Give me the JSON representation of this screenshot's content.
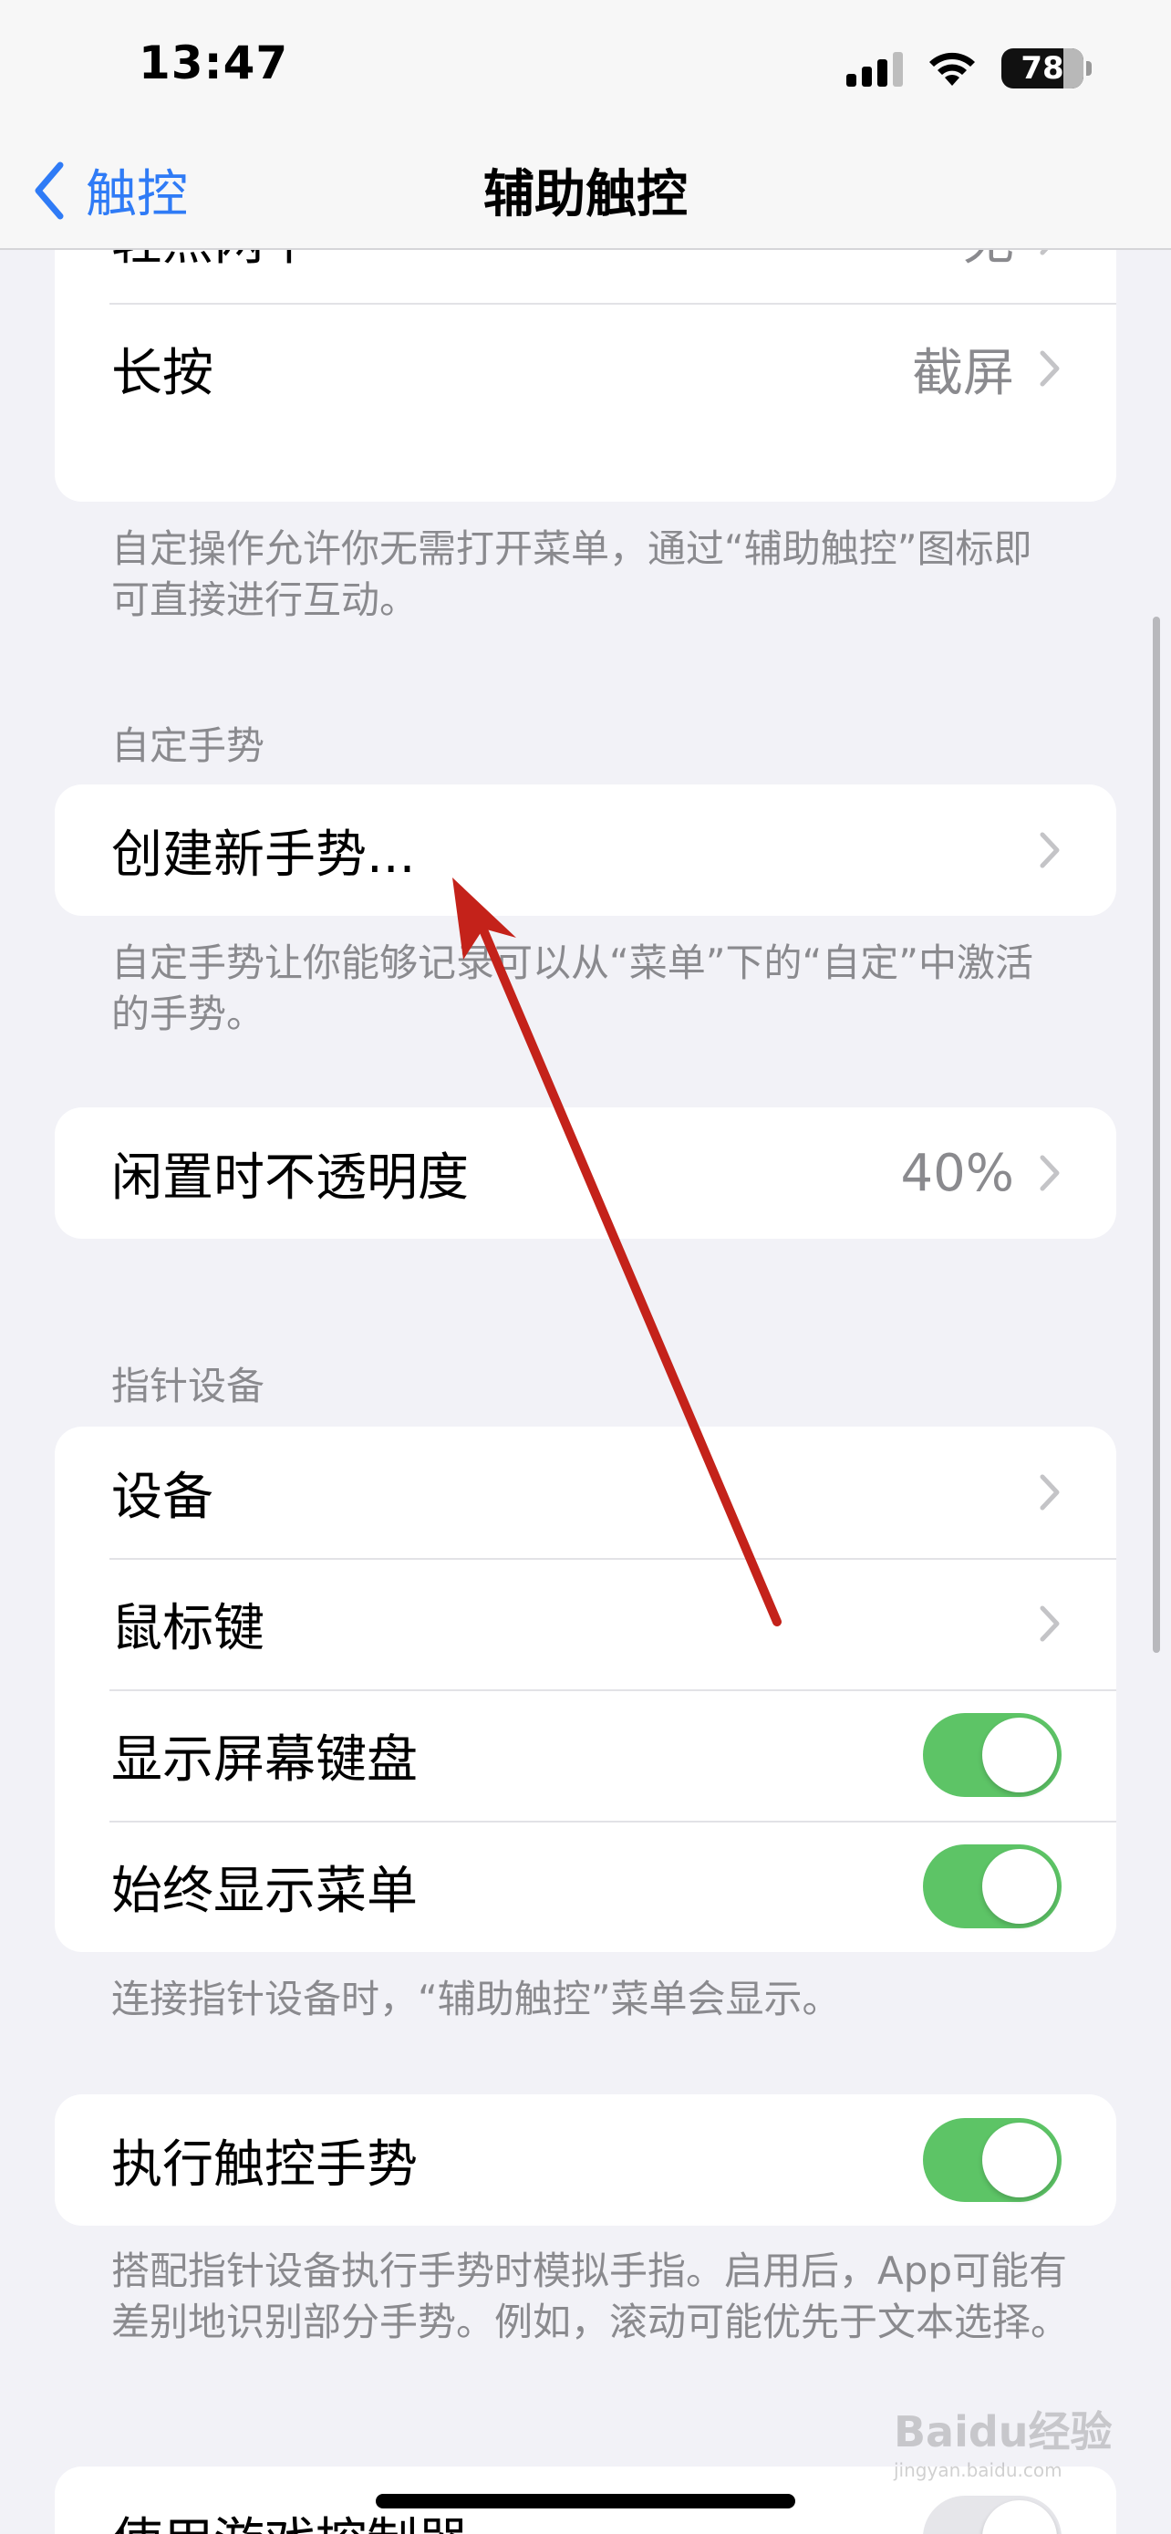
{
  "status_bar": {
    "time": "13:47",
    "battery": "78"
  },
  "nav": {
    "back_label": "触控",
    "title": "辅助触控"
  },
  "custom_actions": {
    "rows": [
      {
        "label": "轻点两下",
        "value": "无"
      },
      {
        "label": "长按",
        "value": "截屏"
      }
    ],
    "footer": "自定操作允许你无需打开菜单，通过“辅助触控”图标即可直接进行互动。"
  },
  "custom_gestures": {
    "header": "自定手势",
    "create_label": "创建新手势...",
    "footer": "自定手势让你能够记录可以从“菜单”下的“自定”中激活的手势。"
  },
  "idle_opacity": {
    "label": "闲置时不透明度",
    "value": "40%"
  },
  "pointer_devices": {
    "header": "指针设备",
    "rows": [
      {
        "label": "设备"
      },
      {
        "label": "鼠标键"
      },
      {
        "label": "显示屏幕键盘",
        "toggle": true
      },
      {
        "label": "始终显示菜单",
        "toggle": true
      }
    ],
    "footer": "连接指针设备时，“辅助触控”菜单会显示。"
  },
  "perform_touch_gestures": {
    "label": "执行触控手势",
    "toggle": true,
    "footer": "搭配指针设备执行手势时模拟手指。启用后，App可能有差别地识别部分手势。例如，滚动可能优先于文本选择。"
  },
  "game_controller": {
    "label": "使用游戏控制器"
  },
  "colors": {
    "accent": "#2f7bf6",
    "toggle_on": "#5dc466",
    "arrow": "#c4221a"
  },
  "watermark": {
    "text": "Baidu经验",
    "url": "jingyan.baidu.com"
  }
}
